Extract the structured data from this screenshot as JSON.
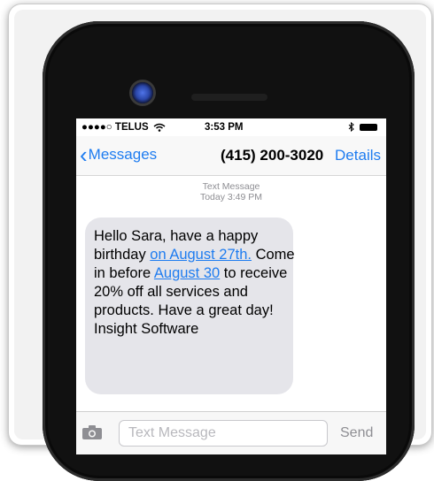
{
  "status_bar": {
    "carrier": "●●●●○ TELUS",
    "wifi_icon": "wifi-icon",
    "time": "3:53 PM",
    "bluetooth_icon": "bluetooth-icon",
    "battery_icon": "battery-icon"
  },
  "nav": {
    "back_label": "Messages",
    "contact": "(415) 200-3020",
    "details_label": "Details"
  },
  "thread": {
    "message_type": "Text Message",
    "timestamp": "Today 3:49 PM"
  },
  "message": {
    "part1": "Hello Sara, have a happy birthday ",
    "link1": "on August 27th.",
    "part2": " Come in before ",
    "link2": "August 30",
    "part3": " to receive 20% off all services and products. Have a great day! Insight Software"
  },
  "compose": {
    "placeholder": "Text Message",
    "send_label": "Send",
    "camera_icon": "camera-icon"
  },
  "colors": {
    "accent": "#1e7cf0",
    "bubble": "#e5e5ea",
    "phone_body": "#111111"
  }
}
